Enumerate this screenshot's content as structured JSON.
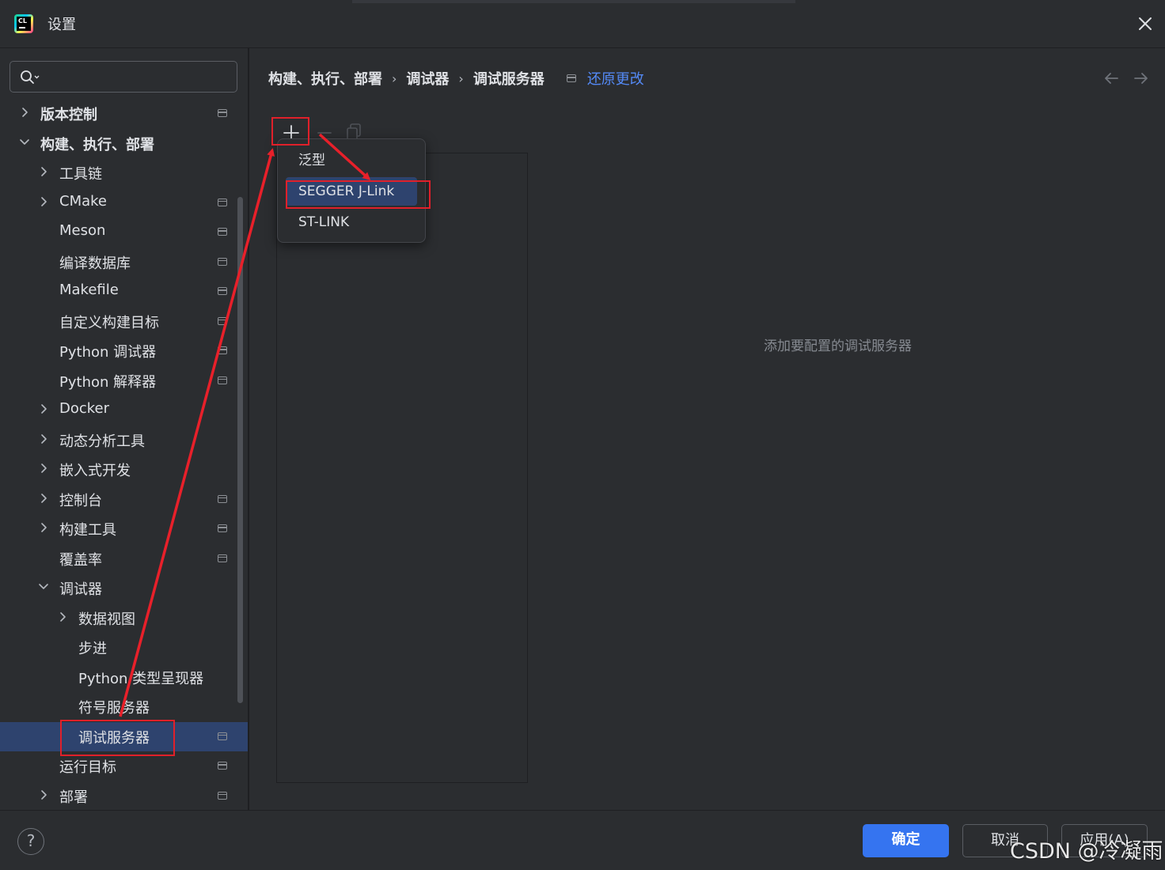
{
  "window": {
    "title": "设置",
    "close_icon": "close-icon"
  },
  "search": {
    "value": "",
    "placeholder": ""
  },
  "tree": [
    {
      "label": "版本控制",
      "expandable": true,
      "expanded": false,
      "bold": true,
      "project_scope": true
    },
    {
      "label": "构建、执行、部署",
      "expandable": true,
      "expanded": true,
      "bold": true,
      "project_scope": false
    },
    {
      "label": "工具链",
      "expandable": true,
      "expanded": false,
      "project_scope": false
    },
    {
      "label": "CMake",
      "expandable": true,
      "expanded": false,
      "project_scope": true
    },
    {
      "label": "Meson",
      "expandable": false,
      "project_scope": true
    },
    {
      "label": "编译数据库",
      "expandable": false,
      "project_scope": true
    },
    {
      "label": "Makefile",
      "expandable": false,
      "project_scope": true
    },
    {
      "label": "自定义构建目标",
      "expandable": false,
      "project_scope": true
    },
    {
      "label": "Python 调试器",
      "expandable": false,
      "project_scope": true
    },
    {
      "label": "Python 解释器",
      "expandable": false,
      "project_scope": true
    },
    {
      "label": "Docker",
      "expandable": true,
      "expanded": false,
      "project_scope": false
    },
    {
      "label": "动态分析工具",
      "expandable": true,
      "expanded": false,
      "project_scope": false
    },
    {
      "label": "嵌入式开发",
      "expandable": true,
      "expanded": false,
      "project_scope": false
    },
    {
      "label": "控制台",
      "expandable": true,
      "expanded": false,
      "project_scope": true
    },
    {
      "label": "构建工具",
      "expandable": true,
      "expanded": false,
      "project_scope": true
    },
    {
      "label": "覆盖率",
      "expandable": false,
      "project_scope": true
    },
    {
      "label": "调试器",
      "expandable": true,
      "expanded": true,
      "project_scope": false
    },
    {
      "label": "数据视图",
      "expandable": true,
      "expanded": false,
      "project_scope": false
    },
    {
      "label": "步进",
      "expandable": false,
      "project_scope": false
    },
    {
      "label": "Python 类型呈现器",
      "expandable": false,
      "project_scope": false
    },
    {
      "label": "符号服务器",
      "expandable": false,
      "project_scope": false
    },
    {
      "label": "调试服务器",
      "expandable": false,
      "project_scope": true,
      "selected": true
    },
    {
      "label": "运行目标",
      "expandable": false,
      "project_scope": true
    },
    {
      "label": "部署",
      "expandable": true,
      "expanded": false,
      "project_scope": true
    }
  ],
  "breadcrumb": {
    "items": [
      "构建、执行、部署",
      "调试器",
      "调试服务器"
    ],
    "separator": "›",
    "revert_label": "还原更改"
  },
  "toolbar": {
    "add_icon": "plus-icon",
    "remove_icon": "minus-icon",
    "copy_icon": "copy-icon"
  },
  "popup_menu": {
    "items": [
      {
        "label": "泛型",
        "highlighted": false
      },
      {
        "label": "SEGGER J-Link",
        "highlighted": true
      },
      {
        "label": "ST-LINK",
        "highlighted": false
      }
    ]
  },
  "empty_message": "添加要配置的调试服务器",
  "footer": {
    "help_label": "?",
    "ok_label": "确定",
    "cancel_label": "取消",
    "apply_label": "应用(A)"
  },
  "watermark": "CSDN @冷凝雨",
  "colors": {
    "background": "#2b2d30",
    "selection": "#2e436e",
    "accent_button": "#3574f0",
    "link": "#548af7",
    "annotation_red": "#e0202a"
  }
}
